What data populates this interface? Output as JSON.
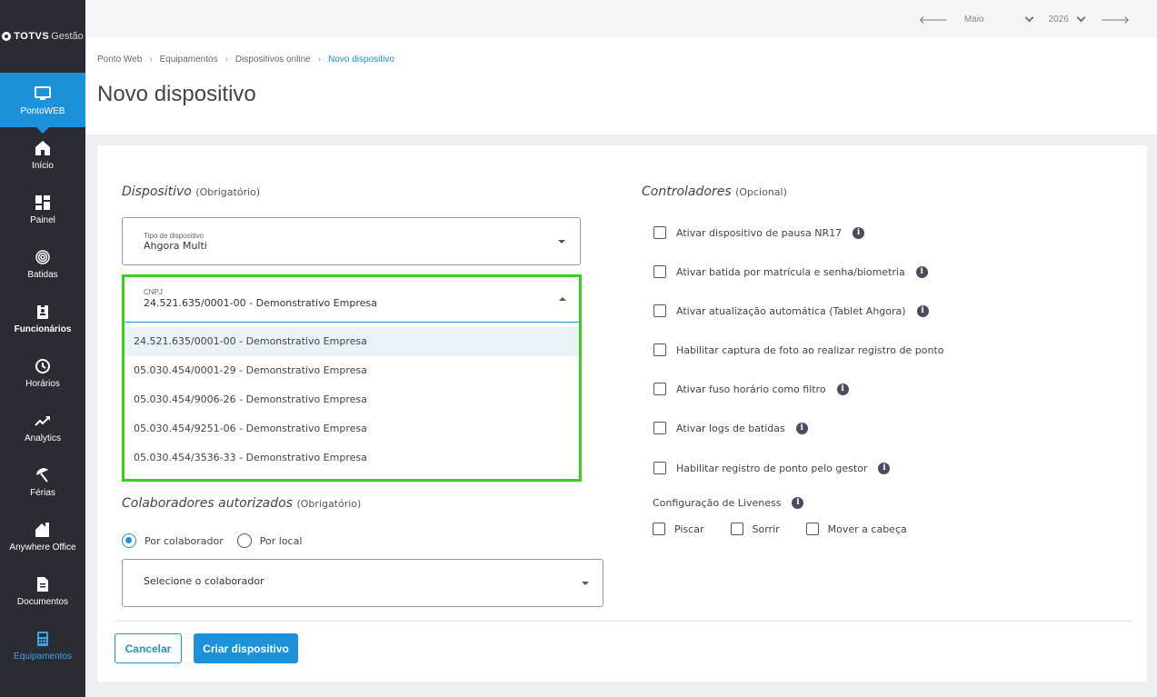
{
  "logo": {
    "brand": "TOTVS",
    "product": "Gestão"
  },
  "sidebar": {
    "items": [
      {
        "label": "PontoWEB",
        "icon": "monitor-icon"
      },
      {
        "label": "Início",
        "icon": "home-icon"
      },
      {
        "label": "Painel",
        "icon": "dashboard-icon"
      },
      {
        "label": "Batidas",
        "icon": "fingerprint-icon"
      },
      {
        "label": "Funcionários",
        "icon": "badge-icon"
      },
      {
        "label": "Horários",
        "icon": "clock-icon"
      },
      {
        "label": "Analytics",
        "icon": "trend-icon"
      },
      {
        "label": "Férias",
        "icon": "umbrella-icon"
      },
      {
        "label": "Anywhere Office",
        "icon": "house-icon"
      },
      {
        "label": "Documentos",
        "icon": "document-icon"
      },
      {
        "label": "Equipamentos",
        "icon": "device-icon"
      }
    ]
  },
  "topbar": {
    "month": "Maio",
    "year": "2026"
  },
  "breadcrumb": [
    "Ponto Web",
    "Equipamentos",
    "Dispositivos online",
    "Novo dispositivo"
  ],
  "page_title": "Novo dispositivo",
  "dispositivo": {
    "title": "Dispositivo",
    "required": "(Obrigatório)",
    "tipo_label": "Tipo de dispositivo",
    "tipo_value": "Ahgora Multi",
    "cnpj_label": "CNPJ",
    "cnpj_value": "24.521.635/0001-00 - Demonstrativo Empresa",
    "cnpj_options": [
      "24.521.635/0001-00 - Demonstrativo Empresa",
      "05.030.454/0001-29 - Demonstrativo Empresa",
      "05.030.454/9006-26 - Demonstrativo Empresa",
      "05.030.454/9251-06 - Demonstrativo Empresa",
      "05.030.454/3536-33 - Demonstrativo Empresa"
    ]
  },
  "colaboradores": {
    "title": "Colaboradores autorizados",
    "required": "(Obrigatório)",
    "radio_1": "Por colaborador",
    "radio_2": "Por local",
    "select_placeholder": "Selecione o colaborador"
  },
  "controladores": {
    "title": "Controladores",
    "optional": "(Opcional)",
    "options": [
      "Ativar dispositivo de pausa NR17",
      "Ativar batida por matrícula e senha/biometria",
      "Ativar atualização automática (Tablet Ahgora)",
      "Habilitar captura de foto ao realizar registro de ponto",
      "Ativar fuso horário como filtro",
      "Ativar logs de batidas",
      "Habilitar registro de ponto pelo gestor"
    ],
    "liveness_title": "Configuração de Liveness",
    "liveness_options": [
      "Piscar",
      "Sorrir",
      "Mover a cabeça"
    ]
  },
  "actions": {
    "cancel": "Cancelar",
    "create": "Criar dispositivo"
  },
  "colors": {
    "accent": "#1d91d9",
    "highlight": "#38d11a",
    "sidebar": "#2a2c33"
  }
}
